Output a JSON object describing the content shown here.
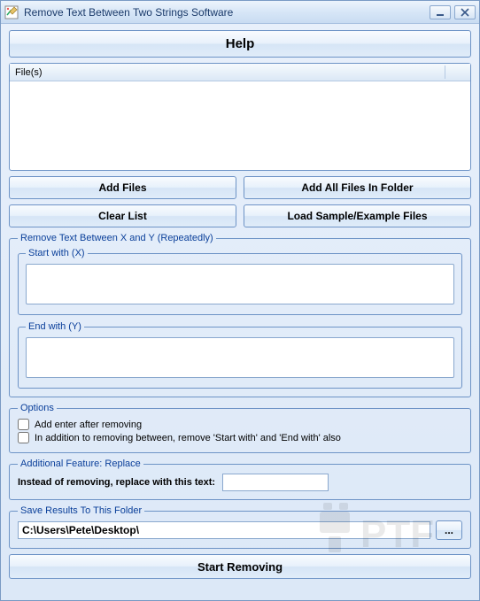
{
  "window": {
    "title": "Remove Text Between Two Strings Software"
  },
  "help": {
    "label": "Help"
  },
  "files": {
    "header": "File(s)"
  },
  "buttons": {
    "add_files": "Add Files",
    "add_all_in_folder": "Add All Files In Folder",
    "clear_list": "Clear List",
    "load_sample": "Load Sample/Example Files",
    "browse": "...",
    "start": "Start Removing"
  },
  "remove_group": {
    "legend": "Remove Text Between X and Y (Repeatedly)",
    "start_legend": "Start with (X)",
    "start_value": "",
    "end_legend": "End with (Y)",
    "end_value": ""
  },
  "options": {
    "legend": "Options",
    "add_enter": {
      "label": "Add enter after removing",
      "checked": false
    },
    "remove_delims": {
      "label": "In addition to removing between, remove 'Start with' and 'End with' also",
      "checked": false
    }
  },
  "replace": {
    "legend": "Additional Feature: Replace",
    "label": "Instead of removing, replace with this text:",
    "value": ""
  },
  "save": {
    "legend": "Save Results To This Folder",
    "path": "C:\\Users\\Pete\\Desktop\\"
  }
}
